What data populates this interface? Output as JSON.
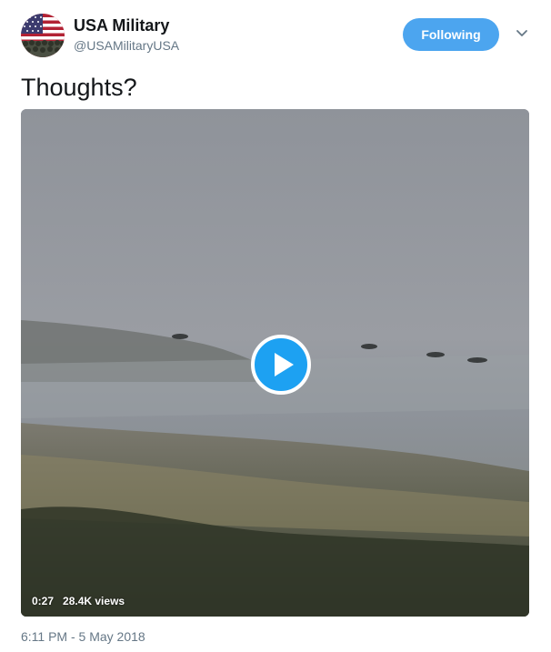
{
  "author": {
    "display_name": "USA Military",
    "handle": "@USAMilitaryUSA",
    "avatar": "us-flag-soldiers-avatar"
  },
  "follow_button": {
    "label": "Following",
    "color": "#4ca5ef"
  },
  "menu": {
    "icon": "chevron-down-icon"
  },
  "tweet": {
    "text": "Thoughts?"
  },
  "video": {
    "duration": "0:27",
    "views": "28.4K views",
    "play_icon": "play-icon"
  },
  "timestamp": "6:11 PM - 5 May 2018",
  "colors": {
    "text_primary": "#14171a",
    "text_secondary": "#657786",
    "accent": "#1da1f2"
  }
}
